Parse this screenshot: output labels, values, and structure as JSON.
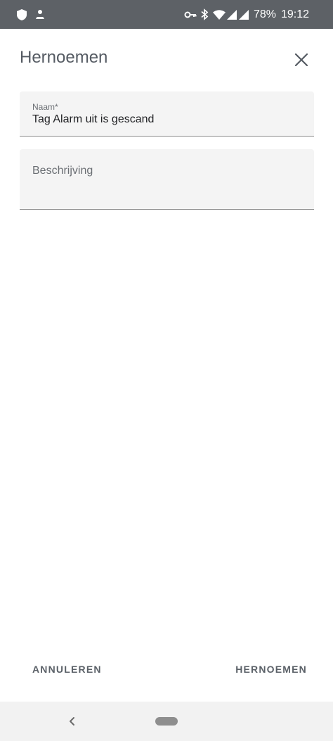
{
  "status_bar": {
    "battery_percent": "78%",
    "time": "19:12",
    "icons": [
      "shield-icon",
      "android-icon",
      "vpn-key-icon",
      "bluetooth-icon",
      "wifi-icon",
      "signal-icon",
      "signal-icon",
      "battery-icon"
    ]
  },
  "dialog": {
    "title": "Hernoemen",
    "close_icon": "close-icon"
  },
  "form": {
    "name_field": {
      "label": "Naam*",
      "value": "Tag Alarm uit is gescand"
    },
    "description_field": {
      "placeholder": "Beschrijving",
      "value": ""
    }
  },
  "actions": {
    "cancel_label": "ANNULEREN",
    "confirm_label": "HERNOEMEN"
  },
  "nav_bar": {
    "icons": [
      "back-icon",
      "home-pill-icon"
    ]
  },
  "colors": {
    "status_bar_bg": "#5d6166",
    "field_bg": "#f4f4f4",
    "title_text": "#555b63",
    "action_text": "#5b6168",
    "nav_bar_bg": "#f2f2f2"
  }
}
